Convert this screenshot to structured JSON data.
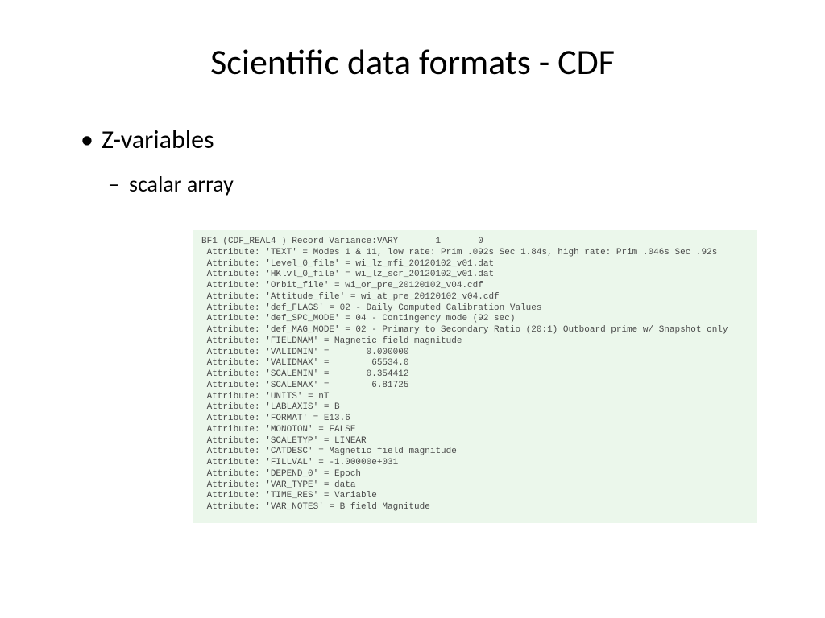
{
  "title": "Scientific data formats - CDF",
  "bullets": {
    "l1": "Z-variables",
    "l2": "scalar array"
  },
  "code": {
    "header": "BF1 (CDF_REAL4 ) Record Variance:VARY       1       0",
    "attrs": [
      " Attribute: 'TEXT' = Modes 1 & 11, low rate: Prim .092s Sec 1.84s, high rate: Prim .046s Sec .92s",
      " Attribute: 'Level_0_file' = wi_lz_mfi_20120102_v01.dat",
      " Attribute: 'HKlvl_0_file' = wi_lz_scr_20120102_v01.dat",
      " Attribute: 'Orbit_file' = wi_or_pre_20120102_v04.cdf",
      " Attribute: 'Attitude_file' = wi_at_pre_20120102_v04.cdf",
      " Attribute: 'def_FLAGS' = 02 - Daily Computed Calibration Values",
      " Attribute: 'def_SPC_MODE' = 04 - Contingency mode (92 sec)",
      " Attribute: 'def_MAG_MODE' = 02 - Primary to Secondary Ratio (20:1) Outboard prime w/ Snapshot only",
      " Attribute: 'FIELDNAM' = Magnetic field magnitude",
      " Attribute: 'VALIDMIN' =       0.000000",
      " Attribute: 'VALIDMAX' =        65534.0",
      " Attribute: 'SCALEMIN' =       0.354412",
      " Attribute: 'SCALEMAX' =        6.81725",
      " Attribute: 'UNITS' = nT",
      " Attribute: 'LABLAXIS' = B",
      " Attribute: 'FORMAT' = E13.6",
      " Attribute: 'MONOTON' = FALSE",
      " Attribute: 'SCALETYP' = LINEAR",
      " Attribute: 'CATDESC' = Magnetic field magnitude",
      " Attribute: 'FILLVAL' = -1.00000e+031",
      " Attribute: 'DEPEND_0' = Epoch",
      " Attribute: 'VAR_TYPE' = data",
      " Attribute: 'TIME_RES' = Variable",
      " Attribute: 'VAR_NOTES' = B field Magnitude"
    ]
  }
}
